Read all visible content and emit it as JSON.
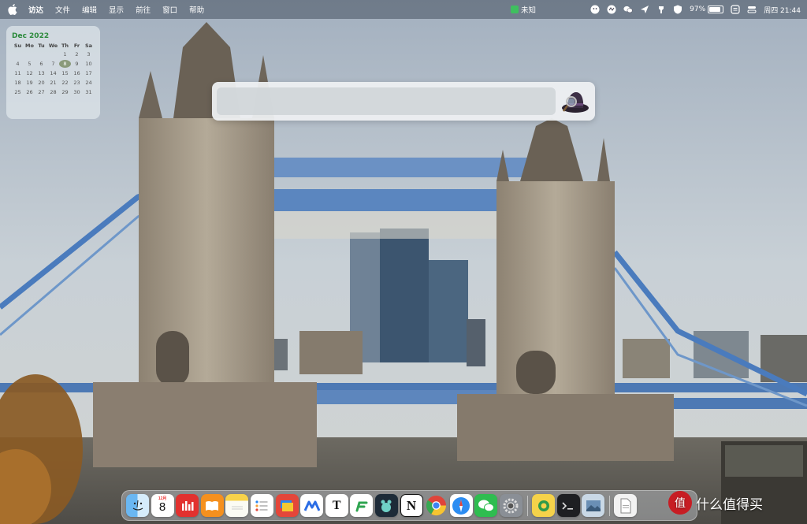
{
  "menubar": {
    "app_name": "访达",
    "items": [
      "文件",
      "编辑",
      "显示",
      "前往",
      "窗口",
      "帮助"
    ],
    "center_status": "未知",
    "battery_percent": "97%",
    "battery_level": 0.97,
    "clock": "周四 21:44"
  },
  "calendar": {
    "title": "Dec 2022",
    "weekdays": [
      "Su",
      "Mo",
      "Tu",
      "We",
      "Th",
      "Fr",
      "Sa"
    ],
    "leading_blank_days": 4,
    "days": [
      "1",
      "2",
      "3",
      "4",
      "5",
      "6",
      "7",
      "8",
      "9",
      "10",
      "11",
      "12",
      "13",
      "14",
      "15",
      "16",
      "17",
      "18",
      "19",
      "20",
      "21",
      "22",
      "23",
      "24",
      "25",
      "26",
      "27",
      "28",
      "29",
      "30",
      "31"
    ],
    "today": "8"
  },
  "alfred": {
    "query": "",
    "placeholder": ""
  },
  "dock": {
    "calendar_icon": {
      "month": "12月",
      "day": "8"
    },
    "text_app_letter": "T",
    "notion_letter": "N",
    "apps": [
      "finder",
      "calendar",
      "netease-music",
      "books",
      "notes",
      "reminders",
      "stacks",
      "lark",
      "typora",
      "stickies",
      "screens",
      "notion",
      "chrome",
      "safari",
      "wechat",
      "system-preferences"
    ],
    "recent": [
      "sparkle",
      "terminal",
      "preview"
    ]
  },
  "watermark": {
    "text": "什么值得买",
    "badge": "值"
  },
  "colors": {
    "accent_green": "#2c8a3c",
    "brand_red": "#c71d24"
  }
}
